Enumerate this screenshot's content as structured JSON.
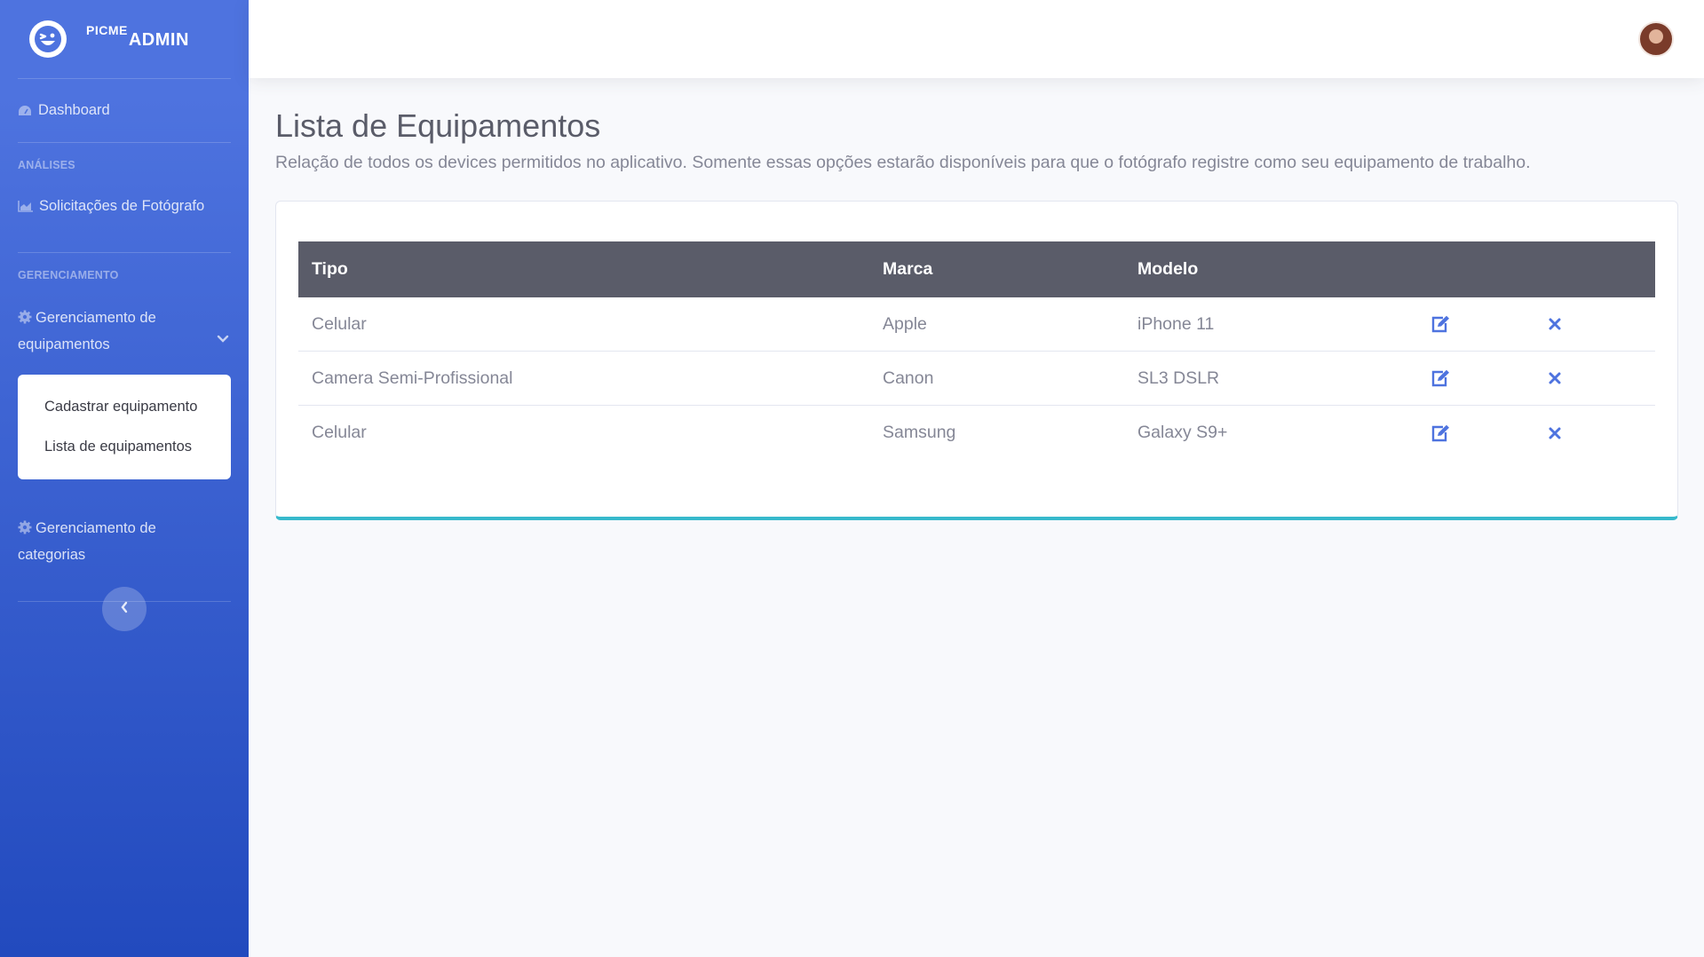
{
  "brand": {
    "picme": "PICME",
    "admin": "ADMIN"
  },
  "sidebar": {
    "dashboard": "Dashboard",
    "heading_analises": "ANÁLISES",
    "solicitacoes": "Solicitações de Fotógrafo",
    "heading_gerenciamento": "GERENCIAMENTO",
    "equip_line1": "Gerenciamento de",
    "equip_line2": "equipamentos",
    "submenu": [
      "Cadastrar equipamento",
      "Lista de equipamentos"
    ],
    "cat_line1": "Gerenciamento de",
    "cat_line2": "categorias"
  },
  "page": {
    "title": "Lista de Equipamentos",
    "subtitle": "Relação de todos os devices permitidos no aplicativo. Somente essas opções estarão disponíveis para que o fotógrafo registre como seu equipamento de trabalho."
  },
  "table": {
    "headers": [
      "Tipo",
      "Marca",
      "Modelo"
    ],
    "rows": [
      {
        "tipo": "Celular",
        "marca": "Apple",
        "modelo": "iPhone 11"
      },
      {
        "tipo": "Camera Semi-Profissional",
        "marca": "Canon",
        "modelo": "SL3 DSLR"
      },
      {
        "tipo": "Celular",
        "marca": "Samsung",
        "modelo": "Galaxy S9+"
      }
    ]
  },
  "colors": {
    "primary": "#4e73df",
    "header_bg": "#5a5c69",
    "card_border_accent": "#36b9cc"
  },
  "icons": {
    "edit": "edit-icon",
    "delete": "close-icon"
  }
}
